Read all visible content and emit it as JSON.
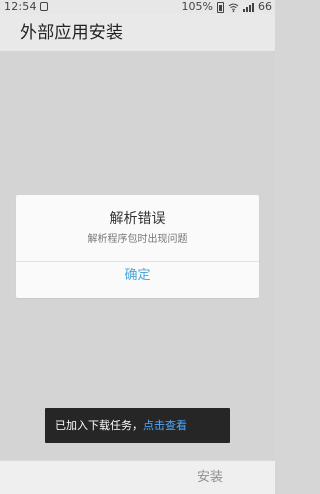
{
  "status_bar": {
    "time": "12:54",
    "battery_percent": "105%",
    "signal_strength_text": "66",
    "icons": {
      "left": "notification-icon",
      "battery": "battery-icon",
      "wifi": "wifi-icon",
      "signal": "signal-icon"
    }
  },
  "header": {
    "title": "外部应用安装"
  },
  "dialog": {
    "title": "解析错误",
    "message": "解析程序包时出现问题",
    "confirm_label": "确定"
  },
  "toast": {
    "message_prefix": "已加入下载任务，",
    "link_text": "点击查看"
  },
  "bottom_bar": {
    "back_icon": "back-triangle-icon",
    "install_label": "安装"
  },
  "colors": {
    "background": "#d4d4d4",
    "header_background": "#e9e9e9",
    "dialog_background": "#fafafa",
    "accent": "#4ba7d8",
    "toast_background": "#262626",
    "toast_link": "#4ea8ff",
    "disabled_text": "#8f8f8f"
  }
}
